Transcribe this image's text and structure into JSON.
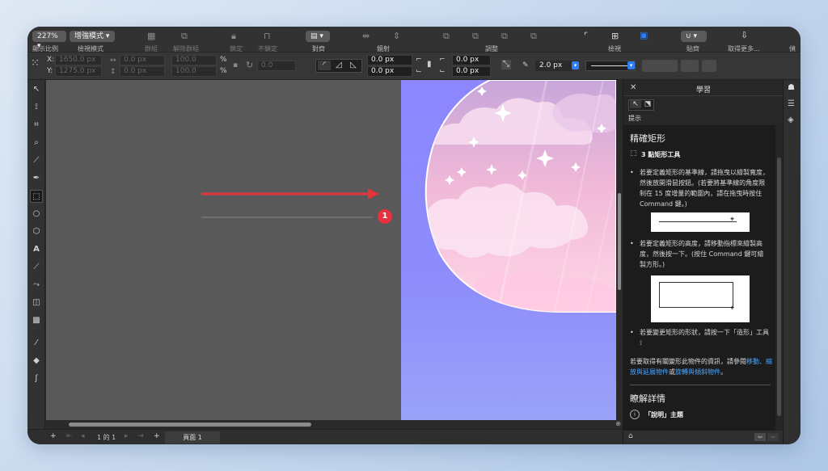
{
  "toolbar": {
    "zoom_value": "227%",
    "zoom_label": "顯示比例",
    "view_mode_value": "增強模式",
    "view_mode_label": "檢視模式",
    "group_label": "群組",
    "ungroup_label": "解除群組",
    "lock_label": "鎖定",
    "unlock_label": "不鎖定",
    "align_label": "對齊",
    "mirror_label": "鏡射",
    "adjust_label": "調整",
    "view_label": "檢視",
    "snap_label": "貼齊",
    "more_label": "取得更多...",
    "last_label": "偵"
  },
  "properties": {
    "x_label": "X:",
    "x_value": "1650.0 px",
    "y_label": "Y:",
    "y_value": "1275.0 px",
    "w_value": "0.0 px",
    "h_value": "0.0 px",
    "scale_w": "100.0",
    "scale_h": "100.0",
    "percent": "%",
    "angle_value": "0.0",
    "corner1": "0.0 px",
    "corner2": "0.0 px",
    "pos1": "0.0 px",
    "pos2": "0.0 px",
    "outline_width": "2.0 px"
  },
  "annotation": {
    "marker_number": "1",
    "arrow_color": "#e6323e"
  },
  "status": {
    "page_indicator": "1 的 1",
    "page_tab": "頁面 1"
  },
  "panel": {
    "title": "學習",
    "hints_label": "提示",
    "heading": "精確矩形",
    "tool_name": "3 點矩形工具",
    "bullet1": "若要定義矩形的基準線，請拖曳以繪製寬度，然後放開滑鼠按鈕。(若要將基準線的角度限制在 15 度增量的範圍內，請在拖曳時按住 Command 鍵。)",
    "bullet2": "若要定義矩形的高度，請移動指標來繪製高度，然後按一下。(按住 Command 鍵可繪製方形。)",
    "bullet3": "若要變更矩形的形狀，請按一下「造形」工具",
    "info_prefix": "若要取得有關變形此物件的資訊，請參閱",
    "info_link1": "移動、縮放與延展物件",
    "info_or": "或",
    "info_link2": "旋轉與傾斜物件",
    "info_suffix": "。",
    "section2": "瞭解詳情",
    "topic_label": "「說明」主題"
  }
}
